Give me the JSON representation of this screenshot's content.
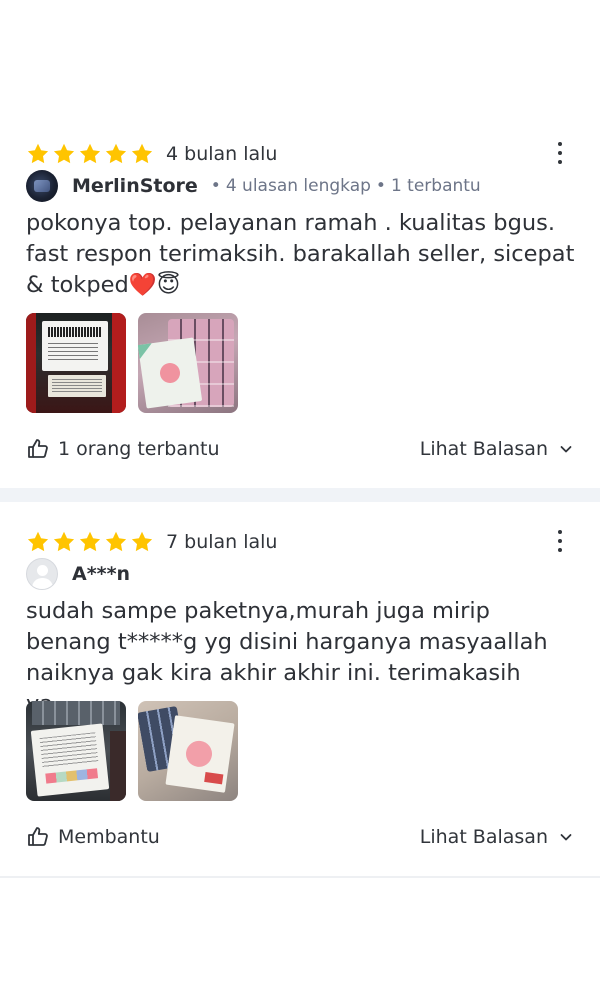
{
  "reviews": [
    {
      "rating": 5,
      "time": "4 bulan lalu",
      "reviewer_name": "MerlinStore",
      "reviewer_reviews": "4 ulasan lengkap",
      "reviewer_helpful": "1 terbantu",
      "text": "pokonya top. pelayanan ramah . kualitas bgus. fast respon terimaksih. barakallah seller, sicepat & tokped❤️😇",
      "image_count": 2,
      "helpful_label": "1 orang terbantu",
      "reply_label": "Lihat Balasan"
    },
    {
      "rating": 5,
      "time": "7 bulan lalu",
      "reviewer_name": "A***n",
      "text": "sudah sampe paketnya,murah juga mirip benang t*****g yg disini harganya masyaallah naiknya gak kira akhir akhir ini. terimakasih ya...",
      "image_count": 2,
      "helpful_label": "Membantu",
      "reply_label": "Lihat Balasan"
    }
  ],
  "separator": "•",
  "icons": {
    "star": "star-icon",
    "more": "more-vertical-icon",
    "like": "thumbs-up-icon",
    "chevron": "chevron-down-icon"
  },
  "colors": {
    "star": "#FFC400",
    "text": "#2E3137",
    "muted": "#6D7588",
    "section_divider": "#F0F3F7"
  }
}
